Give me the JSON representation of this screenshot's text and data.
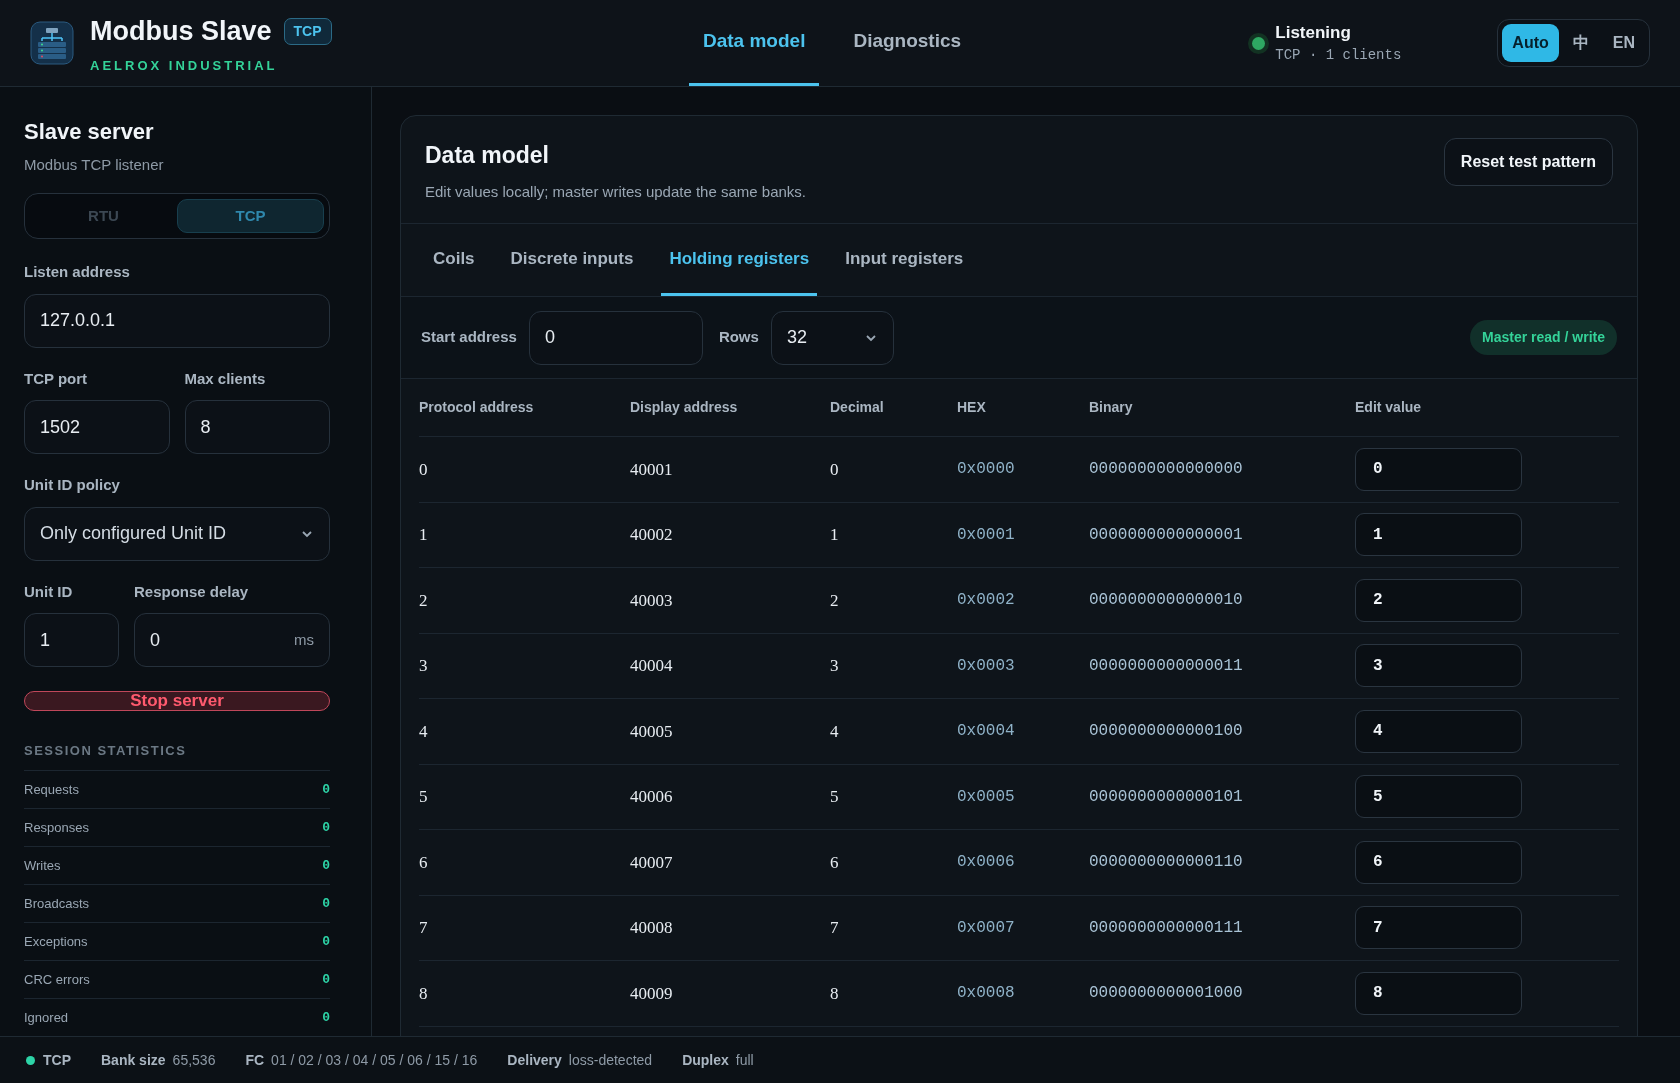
{
  "header": {
    "title": "Modbus Slave",
    "badge": "TCP",
    "subtitle": "AELROX INDUSTRIAL",
    "nav": [
      {
        "label": "Data model",
        "selected": true
      },
      {
        "label": "Diagnostics",
        "selected": false
      }
    ],
    "connection": {
      "label": "Listening",
      "detail": "TCP · 1 clients",
      "on": true
    },
    "languages": [
      {
        "label": "Auto",
        "selected": true
      },
      {
        "label": "中",
        "selected": false
      },
      {
        "label": "EN",
        "selected": false
      }
    ]
  },
  "sidebar": {
    "title": "Slave server",
    "subtitle": "Modbus TCP listener",
    "modes": [
      {
        "label": "RTU",
        "selected": false
      },
      {
        "label": "TCP",
        "selected": true
      }
    ],
    "listen_address": {
      "label": "Listen address",
      "value": "127.0.0.1"
    },
    "tcp_port": {
      "label": "TCP port",
      "value": "1502"
    },
    "max_clients": {
      "label": "Max clients",
      "value": "8"
    },
    "unit_id_policy": {
      "label": "Unit ID policy",
      "value": "Only configured Unit ID"
    },
    "unit_id": {
      "label": "Unit ID",
      "value": "1"
    },
    "response_delay": {
      "label": "Response delay",
      "value": "0",
      "unit": "ms"
    },
    "stop_button": "Stop server",
    "statistics": {
      "title": "SESSION STATISTICS",
      "items": [
        {
          "label": "Requests",
          "value": "0"
        },
        {
          "label": "Responses",
          "value": "0"
        },
        {
          "label": "Writes",
          "value": "0"
        },
        {
          "label": "Broadcasts",
          "value": "0"
        },
        {
          "label": "Exceptions",
          "value": "0"
        },
        {
          "label": "CRC errors",
          "value": "0"
        },
        {
          "label": "Ignored",
          "value": "0"
        }
      ]
    }
  },
  "main": {
    "title": "Data model",
    "description": "Edit values locally; master writes update the same banks.",
    "reset_button": "Reset test pattern",
    "tabs": [
      {
        "label": "Coils",
        "selected": false
      },
      {
        "label": "Discrete inputs",
        "selected": false
      },
      {
        "label": "Holding registers",
        "selected": true
      },
      {
        "label": "Input registers",
        "selected": false
      }
    ],
    "start_address": {
      "label": "Start address",
      "value": "0"
    },
    "rows_select": {
      "label": "Rows",
      "value": "32"
    },
    "access_badge": "Master read / write",
    "table": {
      "columns": [
        "Protocol address",
        "Display address",
        "Decimal",
        "HEX",
        "Binary",
        "Edit value"
      ],
      "rows": [
        [
          "0",
          "40001",
          "0",
          "0x0000",
          "0000000000000000",
          "0"
        ],
        [
          "1",
          "40002",
          "1",
          "0x0001",
          "0000000000000001",
          "1"
        ],
        [
          "2",
          "40003",
          "2",
          "0x0002",
          "0000000000000010",
          "2"
        ],
        [
          "3",
          "40004",
          "3",
          "0x0003",
          "0000000000000011",
          "3"
        ],
        [
          "4",
          "40005",
          "4",
          "0x0004",
          "0000000000000100",
          "4"
        ],
        [
          "5",
          "40006",
          "5",
          "0x0005",
          "0000000000000101",
          "5"
        ],
        [
          "6",
          "40007",
          "6",
          "0x0006",
          "0000000000000110",
          "6"
        ],
        [
          "7",
          "40008",
          "7",
          "0x0007",
          "0000000000000111",
          "7"
        ],
        [
          "8",
          "40009",
          "8",
          "0x0008",
          "0000000000001000",
          "8"
        ]
      ]
    }
  },
  "status_bar": {
    "protocol": "TCP",
    "items": [
      {
        "label": "Bank size",
        "value": "65,536"
      },
      {
        "label": "FC",
        "value": "01 / 02 / 03 / 04 / 05 / 06 / 15 / 16"
      },
      {
        "label": "Delivery",
        "value": "loss-detected"
      },
      {
        "label": "Duplex",
        "value": "full"
      }
    ]
  }
}
